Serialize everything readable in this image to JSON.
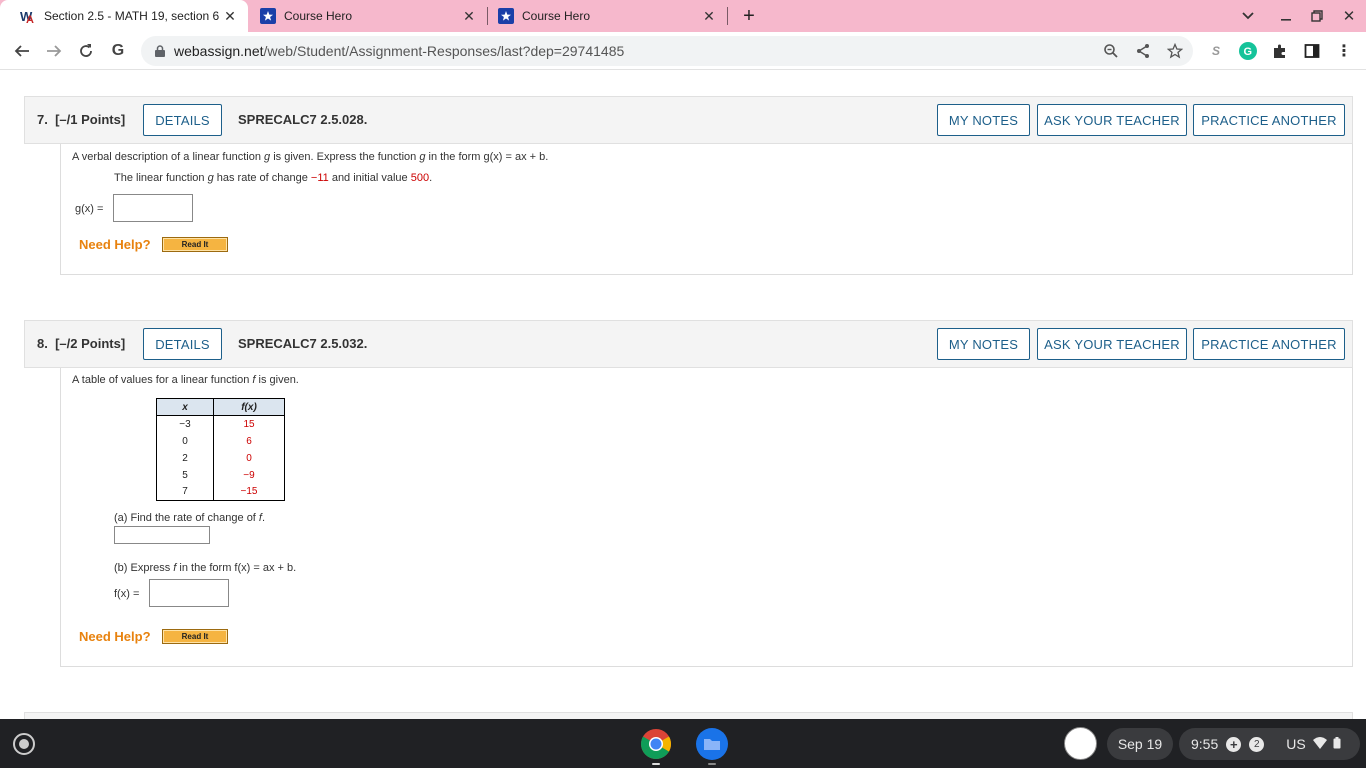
{
  "browser": {
    "tabs": [
      {
        "title": "Section 2.5 - MATH 19, section 6",
        "icon": "webassign-logo-icon",
        "active": true
      },
      {
        "title": "Course Hero",
        "icon": "course-hero-icon",
        "active": false
      },
      {
        "title": "Course Hero",
        "icon": "course-hero-icon",
        "active": false
      }
    ],
    "new_tab": "+",
    "url_host": "webassign.net",
    "url_path": "/web/Student/Assignment-Responses/last?dep=29741485"
  },
  "questions": [
    {
      "number": "7.",
      "points": "[–/1 Points]",
      "details": "DETAILS",
      "code": "SPRECALC7 2.5.028.",
      "my_notes": "MY NOTES",
      "ask_teacher": "ASK YOUR TEACHER",
      "practice": "PRACTICE ANOTHER",
      "prompt_a": "A verbal description of a linear function ",
      "prompt_var": "g",
      "prompt_b": " is given. Express the function ",
      "prompt_var2": "g",
      "prompt_c": " in the form  g(x) = ax + b.",
      "detail_a": "The linear function ",
      "detail_var": "g",
      "detail_b": " has rate of change ",
      "rate": "−11",
      "detail_c": " and initial value ",
      "initial": "500",
      "detail_d": ".",
      "answer_label": "g(x) =",
      "answer_value": "",
      "need_help": "Need Help?",
      "read_it": "Read It"
    },
    {
      "number": "8.",
      "points": "[–/2 Points]",
      "details": "DETAILS",
      "code": "SPRECALC7 2.5.032.",
      "my_notes": "MY NOTES",
      "ask_teacher": "ASK YOUR TEACHER",
      "practice": "PRACTICE ANOTHER",
      "prompt_a": "A table of values for a linear function ",
      "prompt_var": "f",
      "prompt_b": " is given.",
      "table": {
        "headers": [
          "x",
          "f(x)"
        ],
        "rows": [
          [
            "−3",
            "15"
          ],
          [
            "0",
            "6"
          ],
          [
            "2",
            "0"
          ],
          [
            "5",
            "−9"
          ],
          [
            "7",
            "−15"
          ]
        ]
      },
      "part_a": "(a) Find the rate of change of ",
      "part_a_var": "f",
      "part_a_end": ".",
      "part_a_value": "",
      "part_b_a": "(b) Express ",
      "part_b_var": "f",
      "part_b_b": " in the form  f(x) = ax + b.",
      "answer_label": "f(x) =",
      "answer_value": "",
      "need_help": "Need Help?",
      "read_it": "Read It"
    }
  ],
  "taskbar": {
    "date": "Sep 19",
    "time": "9:55",
    "notifications": "2",
    "locale": "US"
  }
}
